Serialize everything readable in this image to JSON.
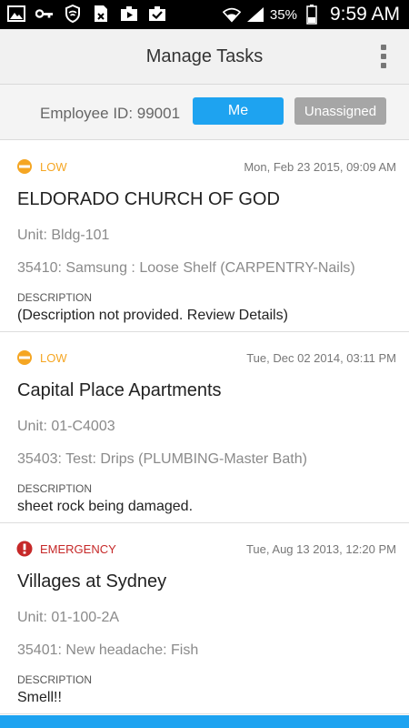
{
  "status_bar": {
    "left_icons": [
      "image-icon",
      "key-icon",
      "shield-icon",
      "sim-icon",
      "briefcase-play-icon",
      "briefcase-check-icon"
    ],
    "battery_pct": "35%",
    "time": "9:59 AM"
  },
  "app_bar": {
    "title": "Manage Tasks"
  },
  "filter": {
    "employee_label": "Employee ID: 99001",
    "me_label": "Me",
    "unassigned_label": "Unassigned"
  },
  "tasks": [
    {
      "priority": "LOW",
      "priority_color": "#f5a623",
      "date": "Mon, Feb 23 2015, 09:09 AM",
      "title": "ELDORADO CHURCH OF GOD",
      "unit": "Unit: Bldg-101",
      "service": "35410: Samsung : Loose Shelf (CARPENTRY-Nails)",
      "description_label": "DESCRIPTION",
      "description": "(Description not provided. Review Details)"
    },
    {
      "priority": "LOW",
      "priority_color": "#f5a623",
      "date": "Tue, Dec 02 2014, 03:11 PM",
      "title": "Capital Place Apartments",
      "unit": "Unit: 01-C4003",
      "service": "35403: Test: Drips  (PLUMBING-Master Bath)",
      "description_label": "DESCRIPTION",
      "description": "sheet rock being damaged."
    },
    {
      "priority": "EMERGENCY",
      "priority_color": "#c62828",
      "date": "Tue, Aug 13 2013, 12:20 PM",
      "title": "Villages at Sydney",
      "unit": "Unit: 01-100-2A",
      "service": "35401: New headache: Fish",
      "description_label": "DESCRIPTION",
      "description": "Smell!!"
    }
  ],
  "colors": {
    "accent": "#1ea3f0",
    "button_inactive": "#a6a6a6"
  }
}
